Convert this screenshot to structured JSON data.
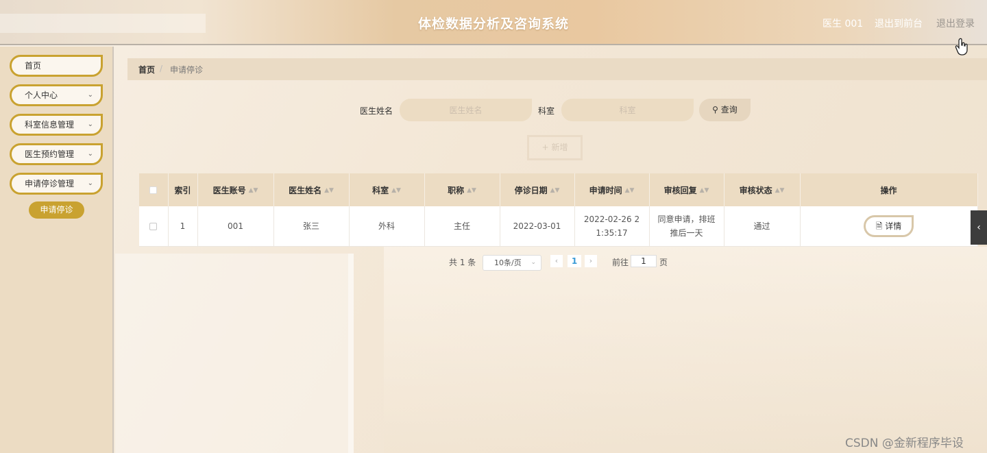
{
  "header": {
    "title": "体检数据分析及咨询系统",
    "user": "医生 001",
    "to_front": "退出到前台",
    "logout": "退出登录"
  },
  "sidebar": {
    "items": [
      {
        "label": "首页"
      },
      {
        "label": "个人中心"
      },
      {
        "label": "科室信息管理"
      },
      {
        "label": "医生预约管理"
      },
      {
        "label": "申请停诊管理"
      }
    ],
    "sub_active": "申请停诊"
  },
  "breadcrumb": {
    "home": "首页",
    "separator": "/",
    "current": "申请停诊"
  },
  "search": {
    "doctor_label": "医生姓名",
    "doctor_placeholder": "医生姓名",
    "dept_label": "科室",
    "dept_placeholder": "科室",
    "query_label": "查询",
    "add_label": "新增"
  },
  "table": {
    "columns": [
      "索引",
      "医生账号",
      "医生姓名",
      "科室",
      "职称",
      "停诊日期",
      "申请时间",
      "审核回复",
      "审核状态",
      "操作"
    ],
    "rows": [
      {
        "index": "1",
        "account": "001",
        "name": "张三",
        "dept": "外科",
        "title": "主任",
        "stop_date": "2022-03-01",
        "apply_time": "2022-02-26 21:35:17",
        "reply": "同意申请，排班推后一天",
        "status": "通过",
        "action": "详情"
      }
    ]
  },
  "pagination": {
    "total": "共 1 条",
    "page_size": "10条/页",
    "current": "1",
    "goto_label": "前往",
    "goto_value": "1",
    "unit": "页"
  },
  "watermark": "CSDN @金新程序毕设",
  "colors": {
    "accent": "#c9a230",
    "sidebar_bg": "#ecdcc3",
    "page_active": "#3a9bd6"
  }
}
